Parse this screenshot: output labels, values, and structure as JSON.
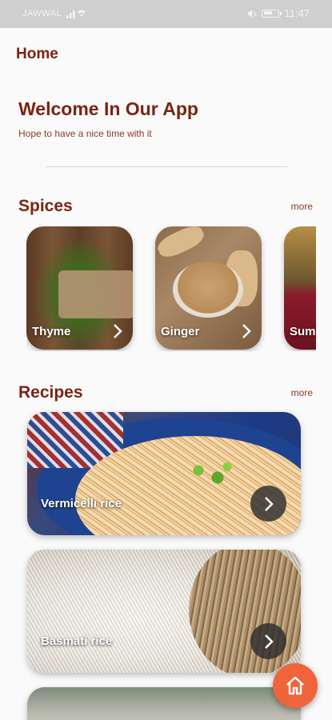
{
  "status_bar": {
    "carrier": "JAWWAL",
    "time": "11:47"
  },
  "app_bar": {
    "title": "Home"
  },
  "welcome": {
    "title": "Welcome In Our App",
    "subtitle": "Hope to have a nice time with it"
  },
  "spices": {
    "title": "Spices",
    "more_label": "more",
    "items": [
      {
        "label": "Thyme"
      },
      {
        "label": "Ginger"
      },
      {
        "label": "Sum"
      }
    ]
  },
  "recipes": {
    "title": "Recipes",
    "more_label": "more",
    "items": [
      {
        "label": "Vermicelli rice"
      },
      {
        "label": "Basmati rice"
      },
      {
        "label": ""
      }
    ]
  },
  "colors": {
    "accent": "#7a2412",
    "fab": "#f0643c",
    "status_bar": "#cfcfcf"
  },
  "icons": [
    "signal-icon",
    "wifi-icon",
    "mute-icon",
    "battery-icon",
    "chevron-right-icon",
    "home-icon"
  ]
}
